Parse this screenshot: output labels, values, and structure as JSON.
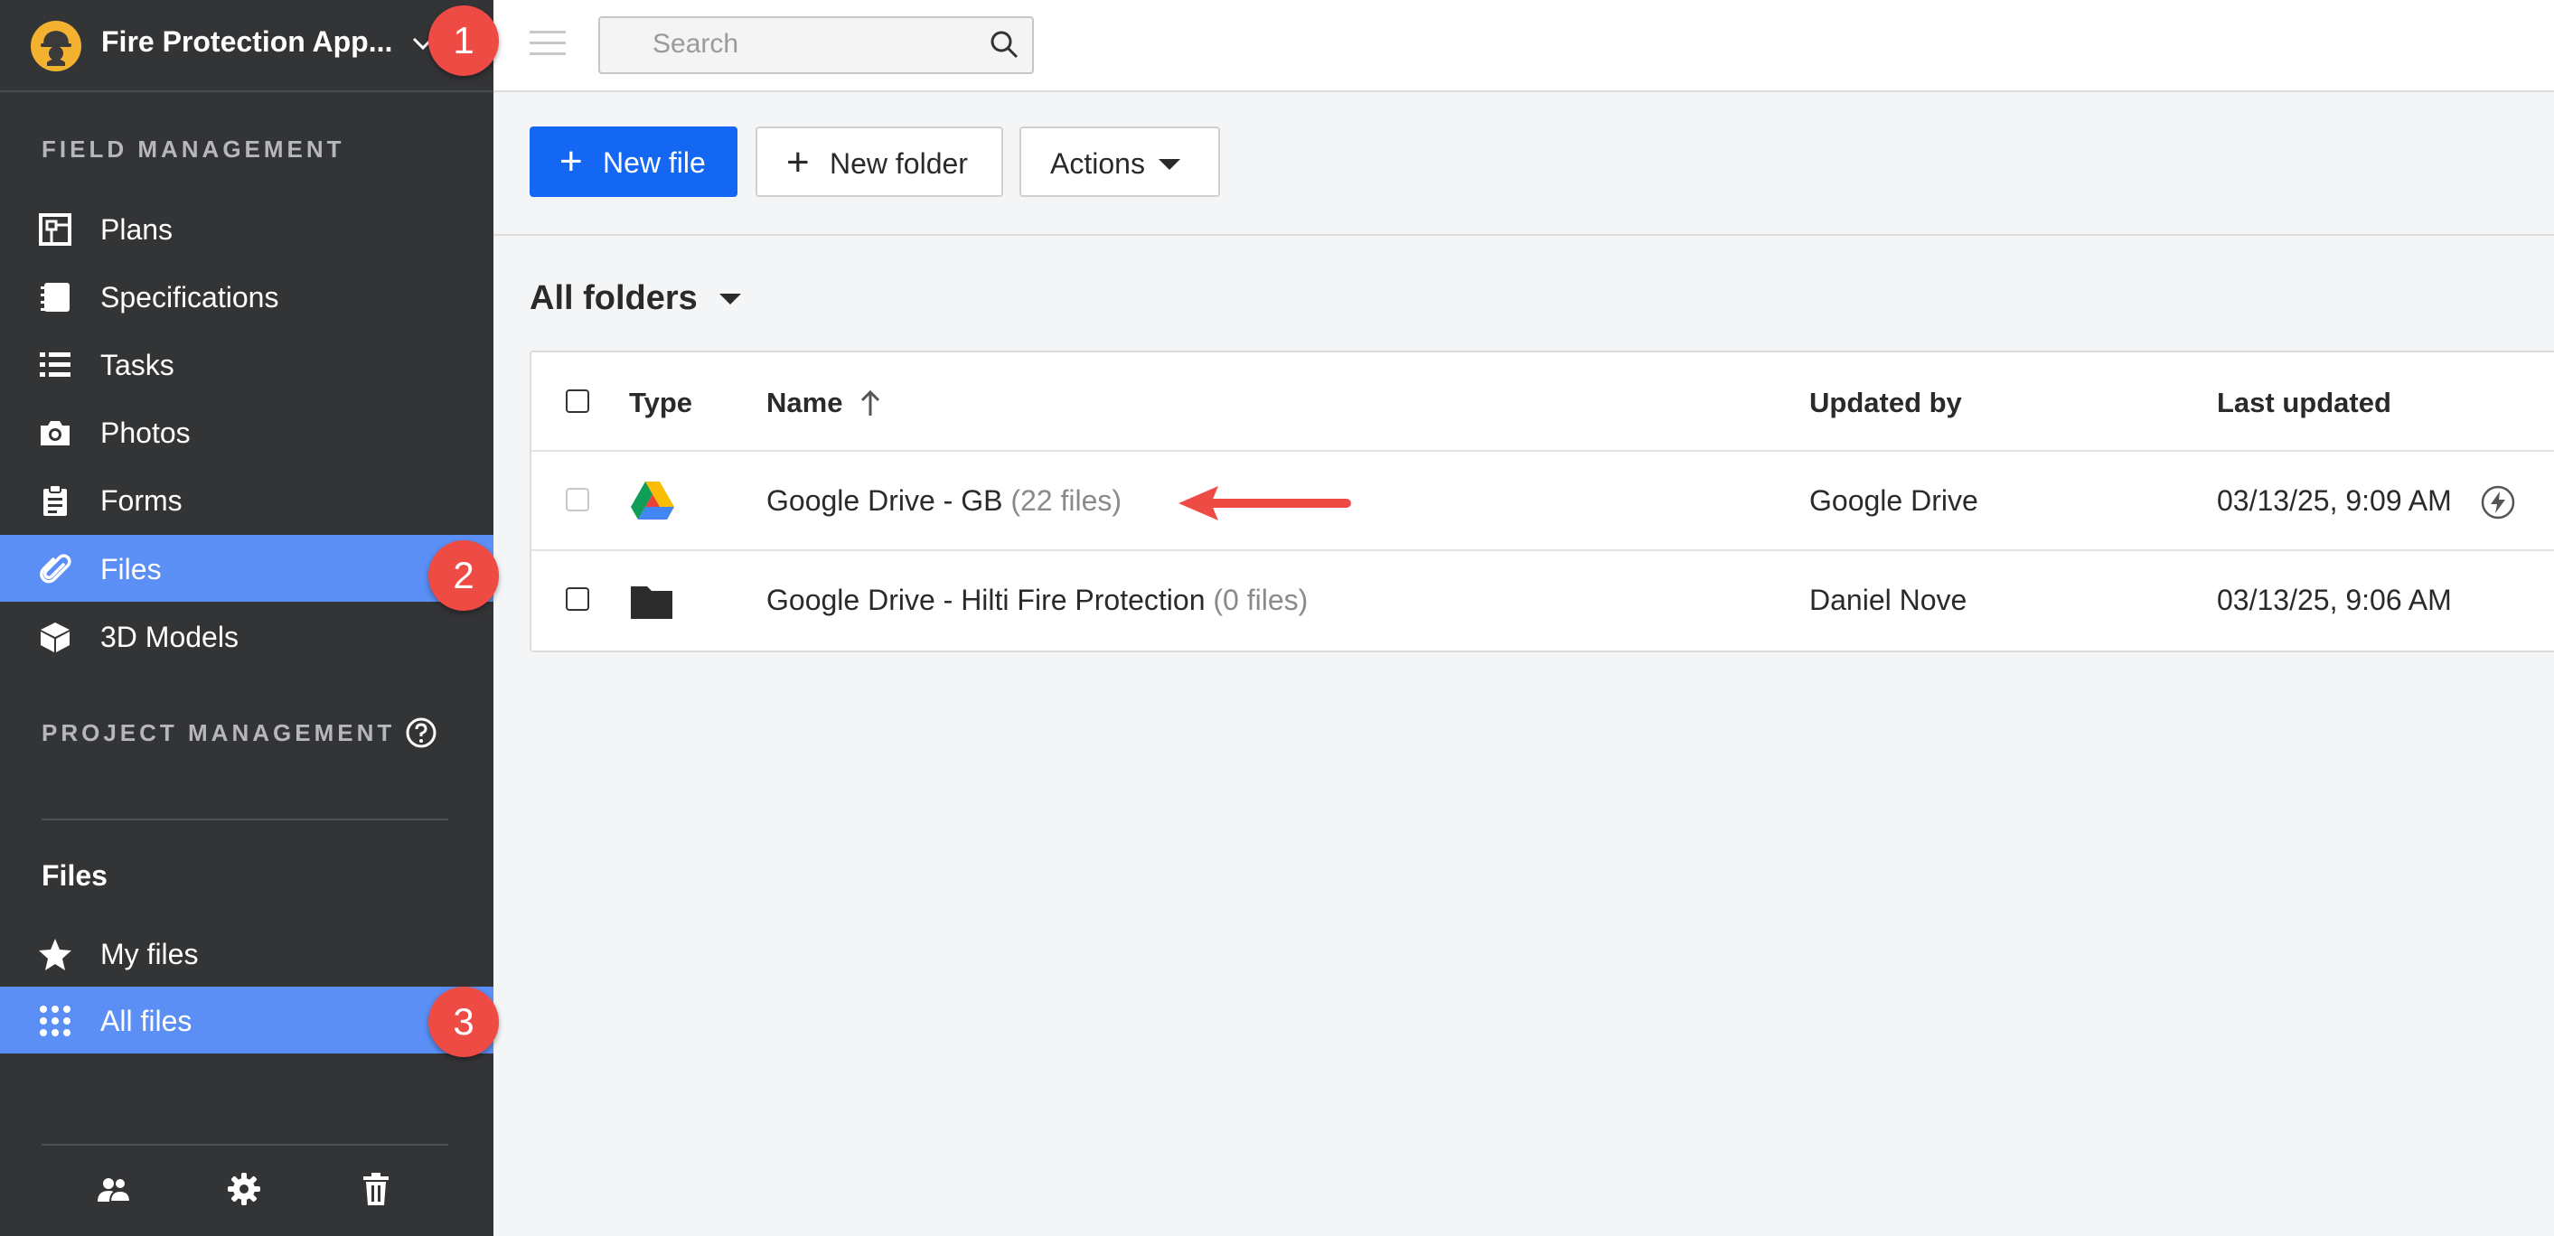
{
  "sidebar": {
    "project_name": "Fire Protection App...",
    "sections": {
      "field_management": "FIELD MANAGEMENT",
      "project_management": "PROJECT MANAGEMENT"
    },
    "field_items": [
      {
        "label": "Plans",
        "icon": "plans-icon"
      },
      {
        "label": "Specifications",
        "icon": "specifications-icon"
      },
      {
        "label": "Tasks",
        "icon": "tasks-list-icon"
      },
      {
        "label": "Photos",
        "icon": "camera-icon"
      },
      {
        "label": "Forms",
        "icon": "clipboard-icon"
      },
      {
        "label": "Files",
        "icon": "paperclip-icon",
        "active": true
      },
      {
        "label": "3D Models",
        "icon": "cube-icon"
      }
    ],
    "files_heading": "Files",
    "files_items": [
      {
        "label": "My files",
        "icon": "star-icon"
      },
      {
        "label": "All files",
        "icon": "grid-dots-icon",
        "active": true
      }
    ],
    "footer_icons": [
      "people-icon",
      "gear-icon",
      "trash-icon"
    ]
  },
  "annotations": {
    "badge1": "1",
    "badge2": "2",
    "badge3": "3"
  },
  "topbar": {
    "search_placeholder": "Search"
  },
  "toolbar": {
    "new_file": "New file",
    "new_folder": "New folder",
    "actions": "Actions"
  },
  "folder_selector": "All folders",
  "table": {
    "headers": {
      "type": "Type",
      "name": "Name",
      "updated_by": "Updated by",
      "last_updated": "Last updated"
    },
    "rows": [
      {
        "name": "Google Drive - GB",
        "count": "(22 files)",
        "updated_by": "Google Drive",
        "last_updated": "03/13/25, 9:09 AM",
        "type_icon": "google-drive-icon"
      },
      {
        "name": "Google Drive - Hilti Fire Protection",
        "count": "(0 files)",
        "updated_by": "Daniel Nove",
        "last_updated": "03/13/25, 9:06 AM",
        "type_icon": "folder-icon"
      }
    ]
  },
  "colors": {
    "sidebar_bg": "#333436",
    "active_bg": "#5b8ff5",
    "primary": "#1467f2",
    "badge": "#ef4b45",
    "logo": "#f2b230"
  }
}
